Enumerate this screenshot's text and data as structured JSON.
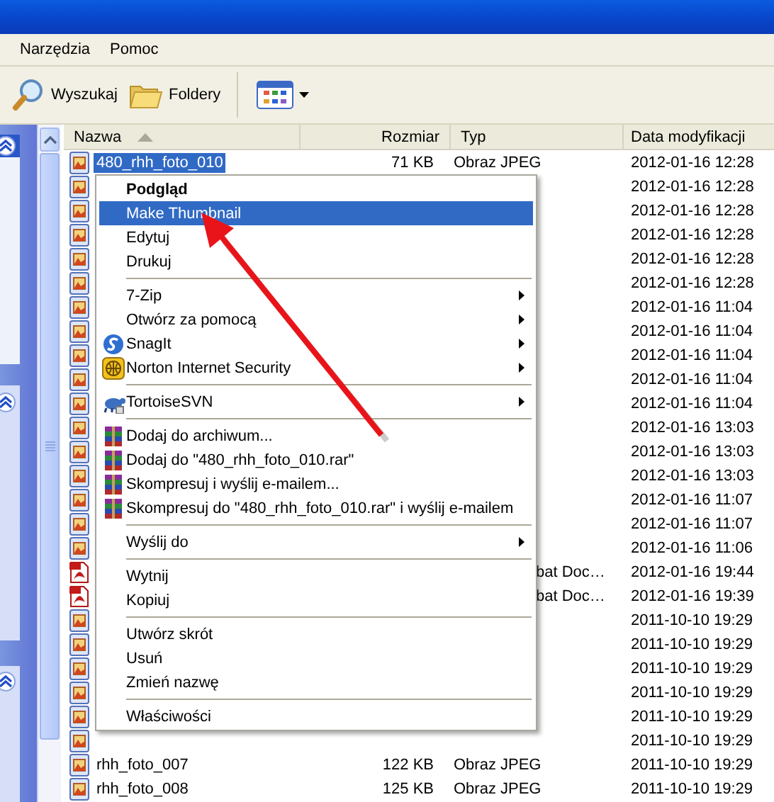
{
  "menu_bar": [
    {
      "label": "Narzędzia"
    },
    {
      "label": "Pomoc"
    }
  ],
  "toolbar": [
    {
      "kind": "search",
      "label": "Wyszukaj"
    },
    {
      "kind": "folders",
      "label": "Foldery"
    },
    {
      "kind": "views"
    }
  ],
  "columns": [
    {
      "label": "Nazwa",
      "sorted": true
    },
    {
      "label": "Rozmiar",
      "sorted": false
    },
    {
      "label": "Typ",
      "sorted": false
    },
    {
      "label": "Data modyfikacji",
      "sorted": false
    }
  ],
  "files": [
    {
      "kind": "jpeg",
      "name": "480_rhh_foto_010",
      "size": "71 KB",
      "type": "Obraz JPEG",
      "modified": "2012-01-16 12:28",
      "selected": true
    },
    {
      "kind": "jpeg",
      "modified": "2012-01-16 12:28",
      "selected": false
    },
    {
      "kind": "jpeg",
      "modified": "2012-01-16 12:28",
      "selected": false
    },
    {
      "kind": "jpeg",
      "modified": "2012-01-16 12:28",
      "selected": false
    },
    {
      "kind": "jpeg",
      "modified": "2012-01-16 12:28",
      "selected": false
    },
    {
      "kind": "jpeg",
      "modified": "2012-01-16 12:28",
      "selected": false
    },
    {
      "kind": "jpeg",
      "modified": "2012-01-16 11:04",
      "selected": false
    },
    {
      "kind": "jpeg",
      "modified": "2012-01-16 11:04",
      "selected": false
    },
    {
      "kind": "jpeg",
      "modified": "2012-01-16 11:04",
      "selected": false
    },
    {
      "kind": "jpeg",
      "modified": "2012-01-16 11:04",
      "selected": false
    },
    {
      "kind": "jpeg",
      "modified": "2012-01-16 11:04",
      "selected": false
    },
    {
      "kind": "jpeg",
      "modified": "2012-01-16 13:03",
      "selected": false
    },
    {
      "kind": "jpeg",
      "modified": "2012-01-16 13:03",
      "selected": false
    },
    {
      "kind": "jpeg",
      "modified": "2012-01-16 13:03",
      "selected": false
    },
    {
      "kind": "jpeg",
      "modified": "2012-01-16 11:07",
      "selected": false
    },
    {
      "kind": "jpeg",
      "modified": "2012-01-16 11:07",
      "selected": false
    },
    {
      "kind": "jpeg",
      "modified": "2012-01-16 11:06",
      "selected": false
    },
    {
      "kind": "pdf",
      "type": "bat Doc…",
      "modified": "2012-01-16 19:44",
      "selected": false
    },
    {
      "kind": "pdf",
      "type": "bat Doc…",
      "modified": "2012-01-16 19:39",
      "selected": false
    },
    {
      "kind": "jpeg",
      "modified": "2011-10-10 19:29",
      "selected": false
    },
    {
      "kind": "jpeg",
      "modified": "2011-10-10 19:29",
      "selected": false
    },
    {
      "kind": "jpeg",
      "modified": "2011-10-10 19:29",
      "selected": false
    },
    {
      "kind": "jpeg",
      "modified": "2011-10-10 19:29",
      "selected": false
    },
    {
      "kind": "jpeg",
      "modified": "2011-10-10 19:29",
      "selected": false
    },
    {
      "kind": "jpeg",
      "modified": "2011-10-10 19:29",
      "selected": false
    },
    {
      "kind": "jpeg",
      "name": "rhh_foto_007",
      "size": "122 KB",
      "type": "Obraz JPEG",
      "modified": "2011-10-10 19:29",
      "selected": false
    },
    {
      "kind": "jpeg",
      "name": "rhh_foto_008",
      "size": "125 KB",
      "type": "Obraz JPEG",
      "modified": "2011-10-10 19:29",
      "selected": false
    }
  ],
  "context_menu": [
    {
      "kind": "plain",
      "label": "Podgląd",
      "default": true,
      "selected": false,
      "submenu": false
    },
    {
      "kind": "plain",
      "label": "Make Thumbnail",
      "default": false,
      "selected": true,
      "submenu": false
    },
    {
      "kind": "plain",
      "label": "Edytuj",
      "default": false,
      "selected": false,
      "submenu": false
    },
    {
      "kind": "plain",
      "label": "Drukuj",
      "default": false,
      "selected": false,
      "submenu": false
    },
    {
      "kind": "separator"
    },
    {
      "kind": "plain",
      "label": "7-Zip",
      "default": false,
      "selected": false,
      "submenu": true
    },
    {
      "kind": "plain",
      "label": "Otwórz za pomocą",
      "default": false,
      "selected": false,
      "submenu": true
    },
    {
      "kind": "snagit",
      "label": "SnagIt",
      "default": false,
      "selected": false,
      "submenu": true
    },
    {
      "kind": "norton",
      "label": "Norton Internet Security",
      "default": false,
      "selected": false,
      "submenu": true
    },
    {
      "kind": "separator"
    },
    {
      "kind": "tortoise",
      "label": "TortoiseSVN",
      "default": false,
      "selected": false,
      "submenu": true
    },
    {
      "kind": "separator"
    },
    {
      "kind": "rar",
      "label": "Dodaj do archiwum...",
      "default": false,
      "selected": false,
      "submenu": false
    },
    {
      "kind": "rar",
      "label": "Dodaj do \"480_rhh_foto_010.rar\"",
      "default": false,
      "selected": false,
      "submenu": false
    },
    {
      "kind": "rar",
      "label": "Skompresuj i wyślij e-mailem...",
      "default": false,
      "selected": false,
      "submenu": false
    },
    {
      "kind": "rar",
      "label": "Skompresuj do \"480_rhh_foto_010.rar\" i wyślij e-mailem",
      "default": false,
      "selected": false,
      "submenu": false
    },
    {
      "kind": "separator"
    },
    {
      "kind": "plain",
      "label": "Wyślij do",
      "default": false,
      "selected": false,
      "submenu": true
    },
    {
      "kind": "separator"
    },
    {
      "kind": "plain",
      "label": "Wytnij",
      "default": false,
      "selected": false,
      "submenu": false
    },
    {
      "kind": "plain",
      "label": "Kopiuj",
      "default": false,
      "selected": false,
      "submenu": false
    },
    {
      "kind": "separator"
    },
    {
      "kind": "plain",
      "label": "Utwórz skrót",
      "default": false,
      "selected": false,
      "submenu": false
    },
    {
      "kind": "plain",
      "label": "Usuń",
      "default": false,
      "selected": false,
      "submenu": false
    },
    {
      "kind": "plain",
      "label": "Zmień nazwę",
      "default": false,
      "selected": false,
      "submenu": false
    },
    {
      "kind": "separator"
    },
    {
      "kind": "plain",
      "label": "Właściwości",
      "default": false,
      "selected": false,
      "submenu": false
    }
  ]
}
